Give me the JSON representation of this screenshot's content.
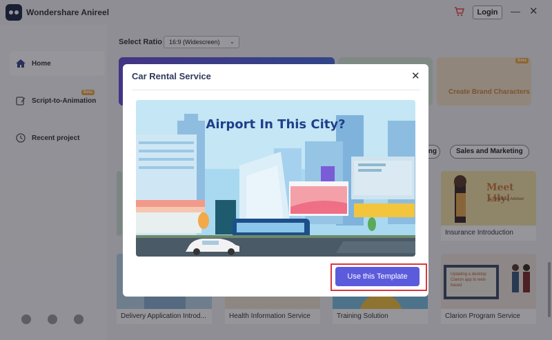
{
  "app": {
    "title": "Wondershare Anireel",
    "login_label": "Login"
  },
  "sidebar": {
    "items": [
      {
        "label": "Home",
        "icon": "home-icon"
      },
      {
        "label": "Script-to-Animation",
        "icon": "script-icon",
        "badge": "Beta"
      },
      {
        "label": "Recent project",
        "icon": "clock-icon"
      }
    ]
  },
  "main": {
    "select_ratio_label": "Select Ratio",
    "ratio_value": "16:9 (Widescreen)",
    "brand_card": {
      "label": "Create Brand Characters",
      "badge": "Beta"
    },
    "category_pill": "Sales and Marketing",
    "category_pill_partial": "ng",
    "templates": [
      {
        "label": "Insurance Introduction"
      },
      {
        "label": "Delivery Application Introd..."
      },
      {
        "label": "Health Information Service"
      },
      {
        "label": "Training Solution"
      },
      {
        "label": "Clarion Program Service"
      }
    ],
    "insurance_card_text": "Meet Lily!",
    "insurance_card_subtext": "a Financial Advisor",
    "clarion_card_text": "Updating a desktop Clarion app to web-based"
  },
  "modal": {
    "title": "Car Rental Service",
    "preview_text": "Airport In This City?",
    "use_button": "Use this Template"
  },
  "colors": {
    "accent": "#5b5bdc",
    "highlight_border": "#d9363e",
    "sky": "#a9d9f0"
  }
}
